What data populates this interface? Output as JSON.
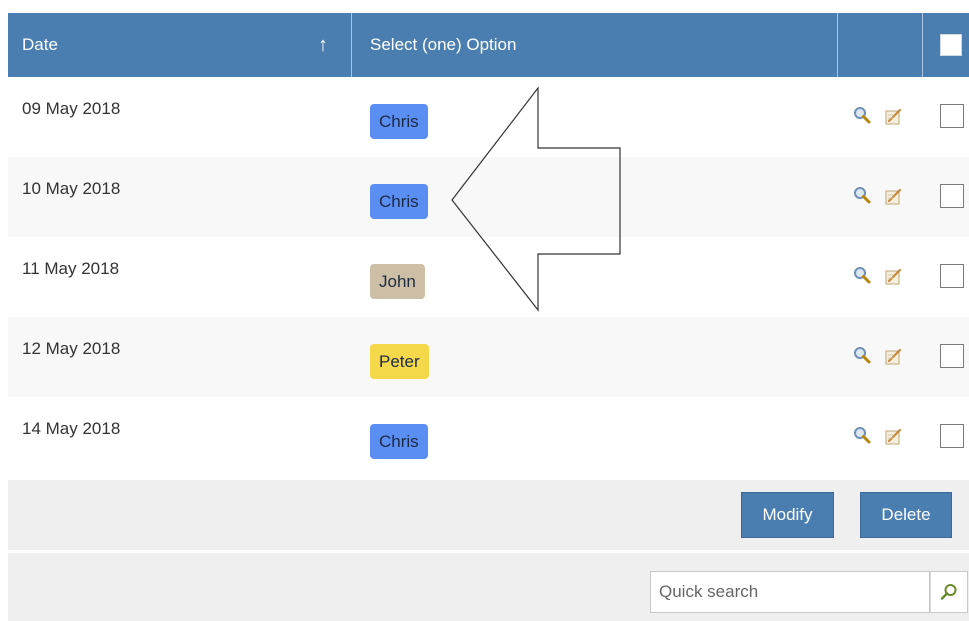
{
  "header": {
    "date_label": "Date",
    "sort_indicator": "↑",
    "option_label": "Select (one) Option",
    "select_all_icon": "checkbox-icon"
  },
  "rows": [
    {
      "date": "09 May 2018",
      "option": "Chris",
      "option_color": "#5b8ef2"
    },
    {
      "date": "10 May 2018",
      "option": "Chris",
      "option_color": "#5b8ef2"
    },
    {
      "date": "11 May 2018",
      "option": "John",
      "option_color": "#cdbfa6"
    },
    {
      "date": "12 May 2018",
      "option": "Peter",
      "option_color": "#f5d94a"
    },
    {
      "date": "14 May 2018",
      "option": "Chris",
      "option_color": "#5b8ef2"
    }
  ],
  "actions": {
    "modify_label": "Modify",
    "delete_label": "Delete"
  },
  "search": {
    "placeholder": "Quick search",
    "icon": "search-icon"
  },
  "colors": {
    "header_bg": "#4a7eb0",
    "button_bg": "#4a7eb0"
  }
}
